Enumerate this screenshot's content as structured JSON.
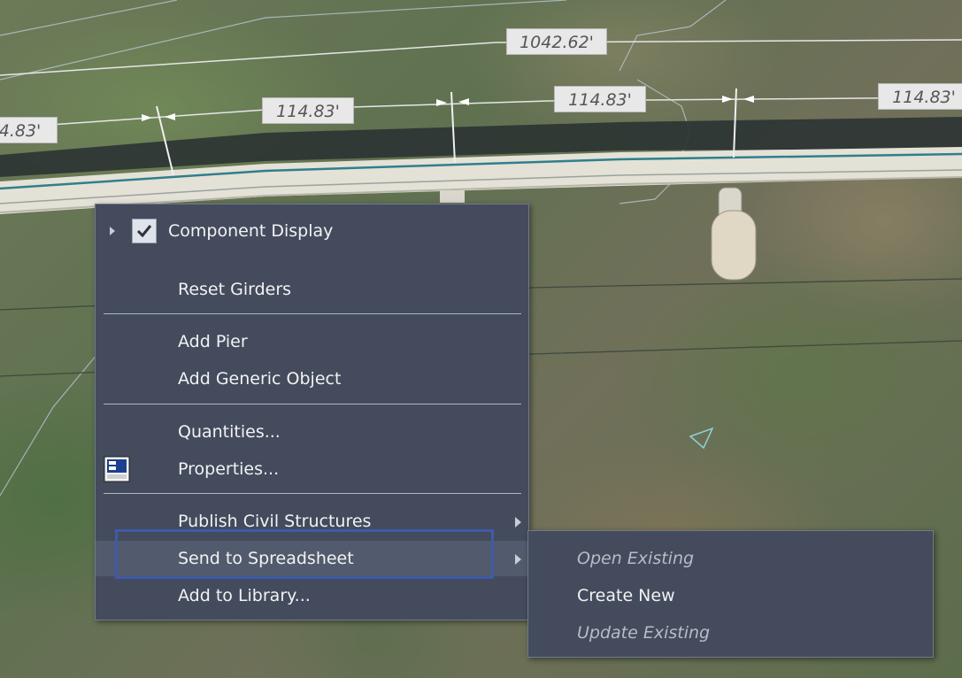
{
  "dimensions": {
    "total": "1042.62'",
    "span_left": "4.83'",
    "span_1": "114.83'",
    "span_2": "114.83'",
    "span_3": "114.83'"
  },
  "context_menu": {
    "items": [
      {
        "label": "Component Display",
        "checked": true,
        "expandable": true
      },
      {
        "label": "Reset Girders"
      },
      {
        "label": "Add Pier"
      },
      {
        "label": "Add Generic Object"
      },
      {
        "label": "Quantities..."
      },
      {
        "label": "Properties...",
        "icon": "properties-icon"
      },
      {
        "label": "Publish Civil Structures",
        "submenu": true
      },
      {
        "label": "Send to Spreadsheet",
        "submenu": true,
        "highlighted": true
      },
      {
        "label": "Add to Library..."
      }
    ]
  },
  "submenu": {
    "items": [
      {
        "label": "Open Existing",
        "enabled": false
      },
      {
        "label": "Create New",
        "enabled": true
      },
      {
        "label": "Update Existing",
        "enabled": false
      }
    ]
  },
  "colors": {
    "menu_bg": "#434b5d",
    "menu_border": "#707a8e",
    "highlight_outline": "#3f5aa8",
    "text": "#f2f2f2",
    "dimension_label_bg": "#e8e8e8"
  }
}
